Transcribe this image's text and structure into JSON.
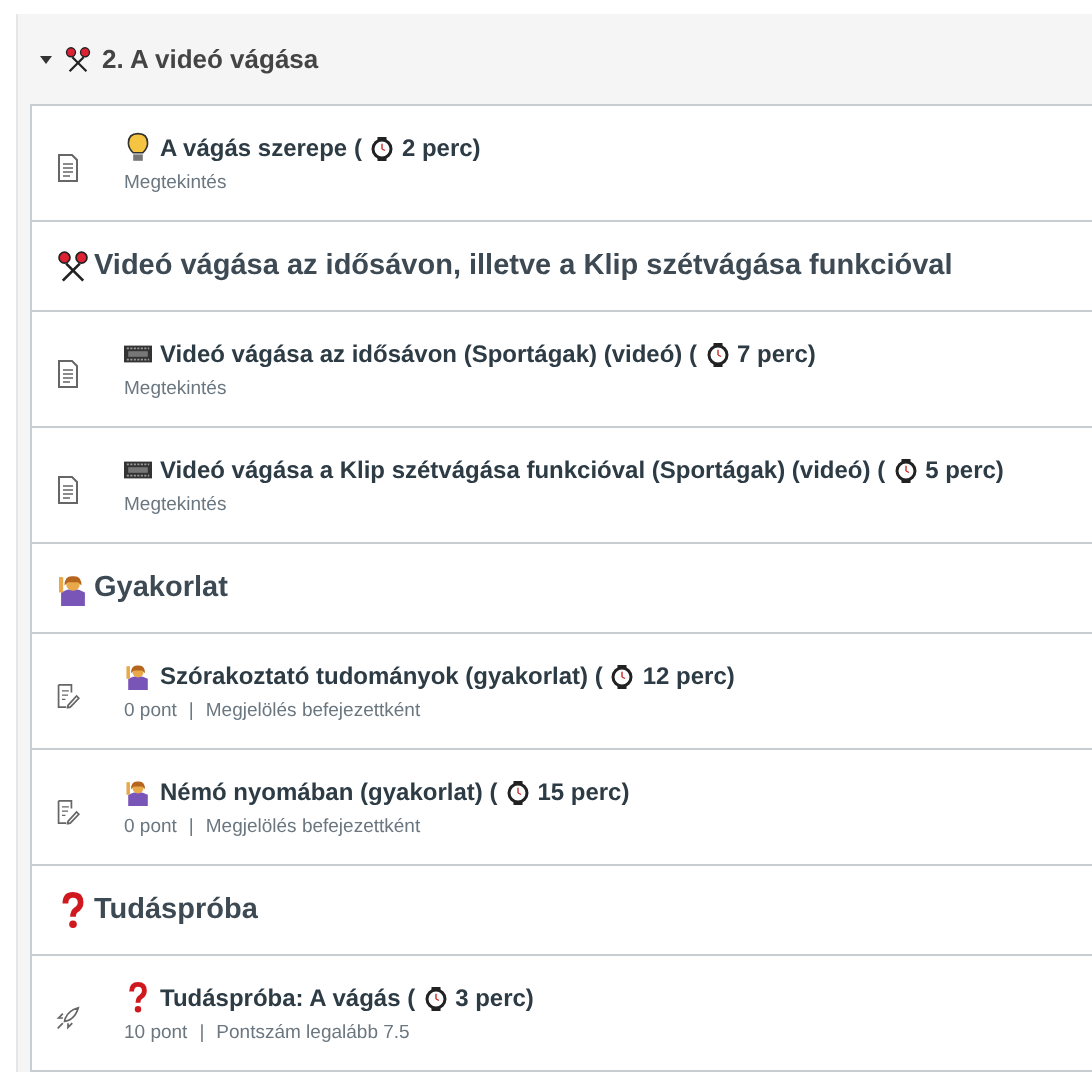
{
  "module": {
    "expanded": true,
    "badge": {
      "kind": "scissors"
    },
    "title": "2. A videó vágása"
  },
  "rows": [
    {
      "kind": "page",
      "badge": {
        "kind": "bulb"
      },
      "title": "A vágás szerepe (",
      "duration": "2 perc)",
      "meta": [
        "Megtekintés"
      ]
    },
    {
      "kind": "header",
      "badge": {
        "kind": "scissors"
      },
      "title": "Videó vágása az idősávon, illetve a Klip szétvágása funkcióval"
    },
    {
      "kind": "page",
      "badge": {
        "kind": "film"
      },
      "title": "Videó vágása az idősávon (Sportágak) (videó) (",
      "duration": "7 perc)",
      "meta": [
        "Megtekintés"
      ]
    },
    {
      "kind": "page",
      "badge": {
        "kind": "film"
      },
      "title": "Videó vágása a Klip szétvágása funkcióval (Sportágak) (videó) (",
      "duration": "5 perc)",
      "meta": [
        "Megtekintés"
      ]
    },
    {
      "kind": "header",
      "badge": {
        "kind": "person"
      },
      "title": "Gyakorlat"
    },
    {
      "kind": "assignment",
      "badge": {
        "kind": "person"
      },
      "title": "Szórakoztató tudományok (gyakorlat) (",
      "duration": "12 perc)",
      "meta": [
        "0 pont",
        "|",
        "Megjelölés befejezettként"
      ]
    },
    {
      "kind": "assignment",
      "badge": {
        "kind": "person"
      },
      "title": "Némó nyomában (gyakorlat) (",
      "duration": "15 perc)",
      "meta": [
        "0 pont",
        "|",
        "Megjelölés befejezettként"
      ]
    },
    {
      "kind": "header",
      "badge": {
        "kind": "question"
      },
      "title": "Tudáspróba"
    },
    {
      "kind": "quiz",
      "badge": {
        "kind": "question"
      },
      "title": "Tudáspróba: A vágás (",
      "duration": "3 perc)",
      "meta": [
        "10 pont",
        "|",
        "Pontszám legalább 7.5"
      ]
    }
  ]
}
